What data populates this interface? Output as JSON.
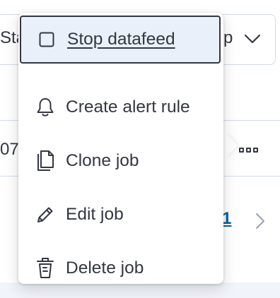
{
  "background": {
    "toolbar_left_text": "Sta",
    "toolbar_right_text": "p",
    "row_text": "07",
    "pagination_current": "1"
  },
  "menu": {
    "items": [
      {
        "label": "Stop datafeed",
        "icon": "stop-square-icon",
        "focused": true
      },
      {
        "label": "Create alert rule",
        "icon": "bell-icon"
      },
      {
        "label": "Clone job",
        "icon": "copy-icon"
      },
      {
        "label": "Edit job",
        "icon": "pencil-icon"
      },
      {
        "label": "Delete job",
        "icon": "trash-icon"
      }
    ]
  },
  "colors": {
    "text": "#343741",
    "focus_background": "#e9f0fa",
    "link": "#0061a6",
    "border": "#d3dae6"
  }
}
